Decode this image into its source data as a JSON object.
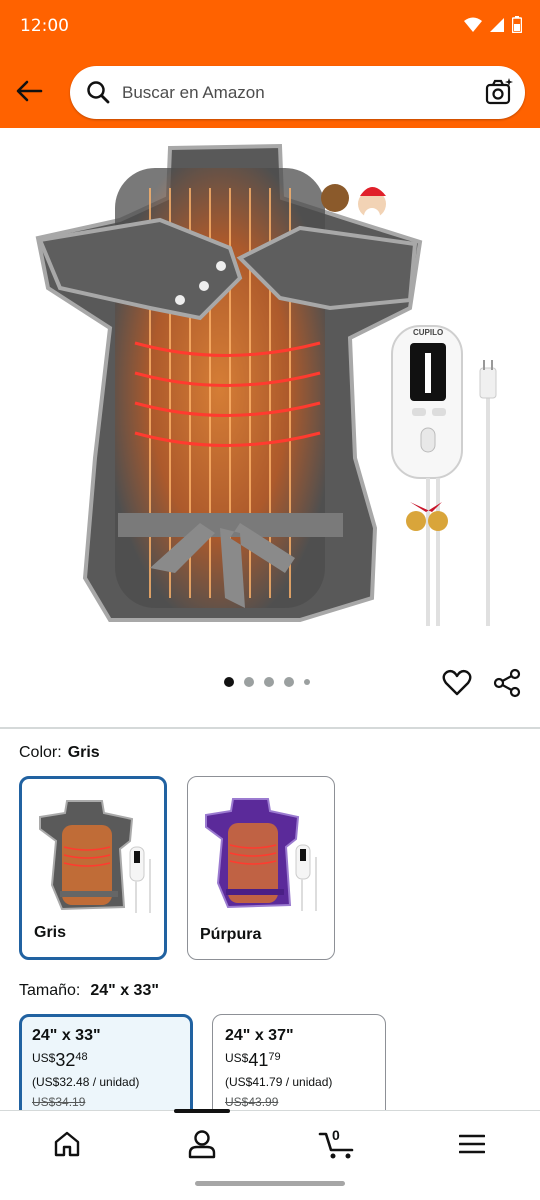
{
  "status_bar": {
    "time": "12:00"
  },
  "header": {
    "back_icon": "arrow-left-icon",
    "search_placeholder": "Buscar en Amazon",
    "camera_icon": "camera-search-icon",
    "brand_color": "#ff6200"
  },
  "gallery": {
    "image_count": 5,
    "active_index": 0,
    "product_label": "CUPILO"
  },
  "color": {
    "label": "Color:",
    "selected": "Gris",
    "options": [
      {
        "name": "Gris",
        "selected": true
      },
      {
        "name": "Púrpura",
        "selected": false
      }
    ]
  },
  "size": {
    "label": "Tamaño:",
    "selected": "24\" x 33\"",
    "options": [
      {
        "size": "24\" x 33\"",
        "currency": "US$",
        "whole": "32",
        "cents": "48",
        "unit_price": "(US$32.48 / unidad)",
        "was": "US$34.19",
        "selected": true
      },
      {
        "size": "24\" x 37\"",
        "currency": "US$",
        "whole": "41",
        "cents": "79",
        "unit_price": "(US$41.79 / unidad)",
        "was": "US$43.99",
        "selected": false
      }
    ]
  },
  "bottom_nav": {
    "cart_count": "0",
    "items": [
      "home-icon",
      "account-icon",
      "cart-icon",
      "menu-icon"
    ]
  }
}
